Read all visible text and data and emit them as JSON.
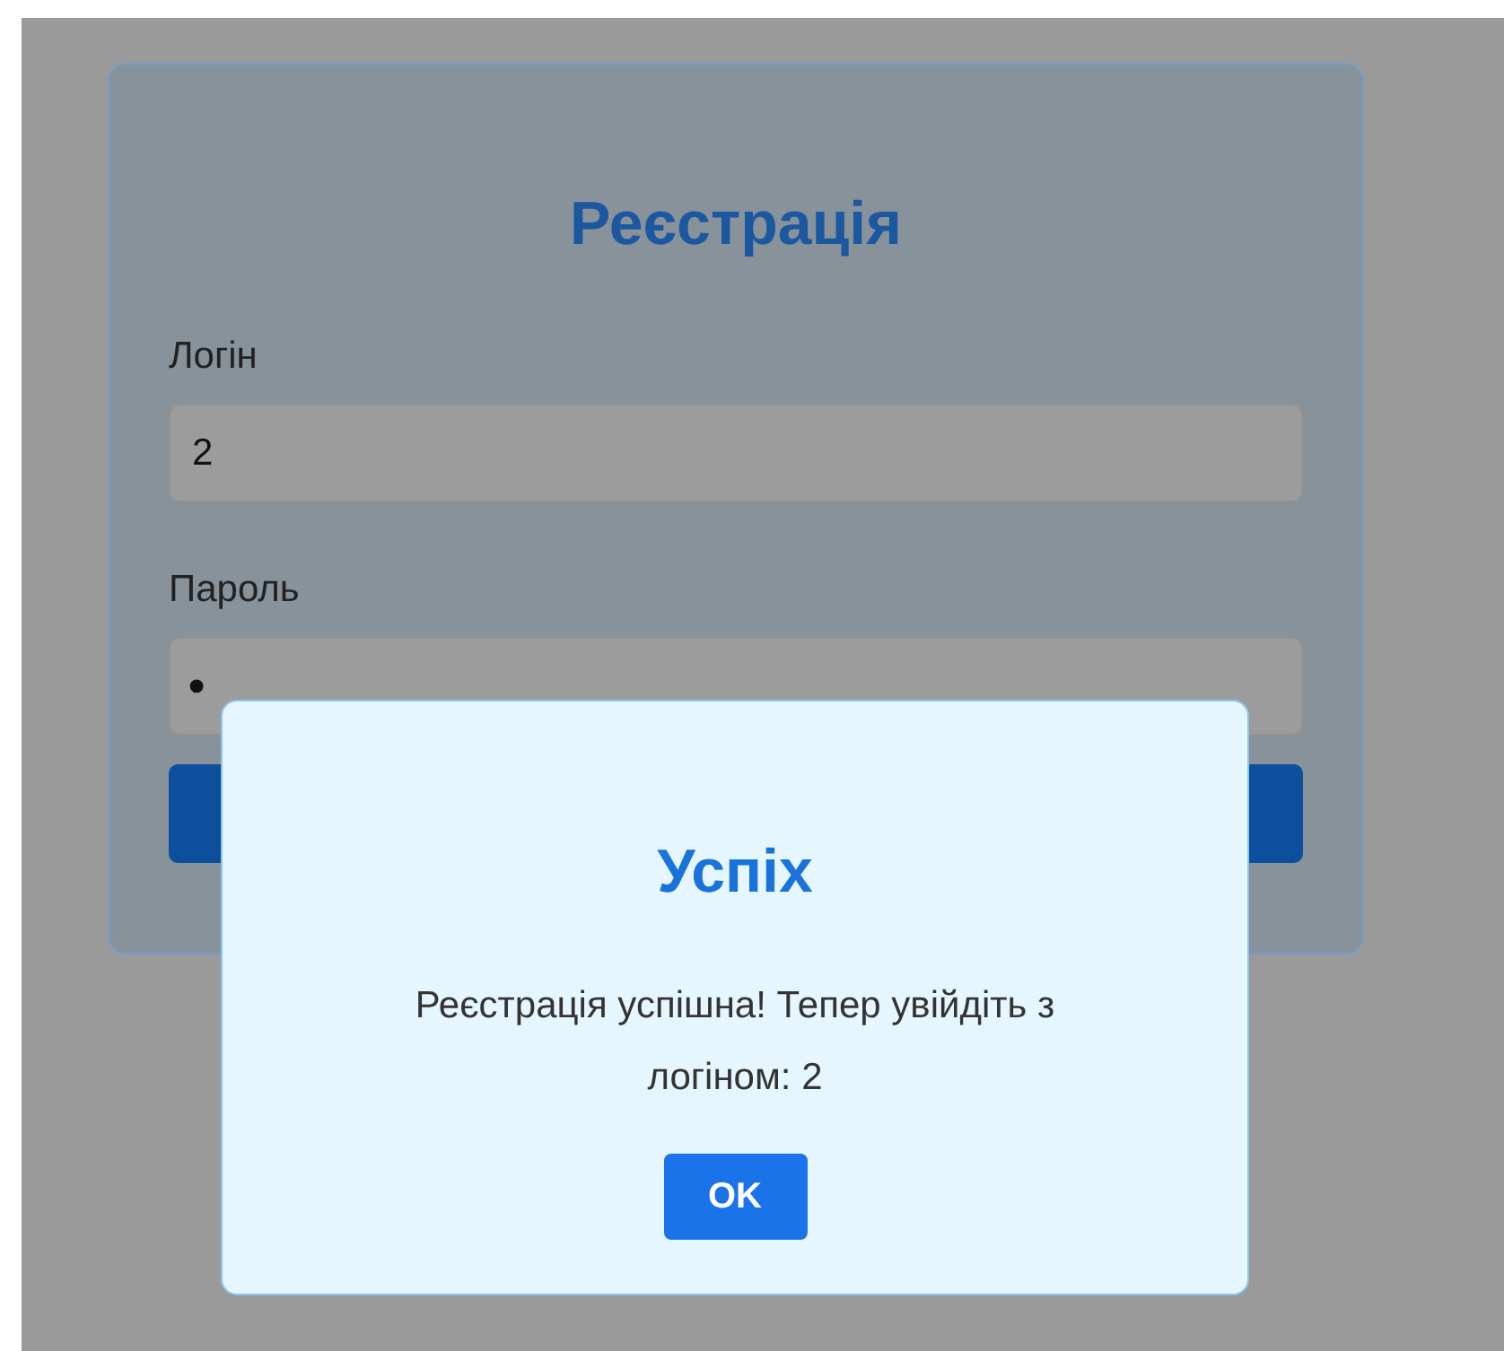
{
  "form": {
    "title": "Реєстрація",
    "fields": [
      {
        "label": "Логін",
        "value": "2",
        "kind": "text"
      },
      {
        "label": "Пароль",
        "value": "•",
        "kind": "password"
      }
    ]
  },
  "dialog": {
    "title": "Успіх",
    "message": "Реєстрація успішна! Тепер увійдіть з логіном: 2",
    "button": "OK"
  }
}
